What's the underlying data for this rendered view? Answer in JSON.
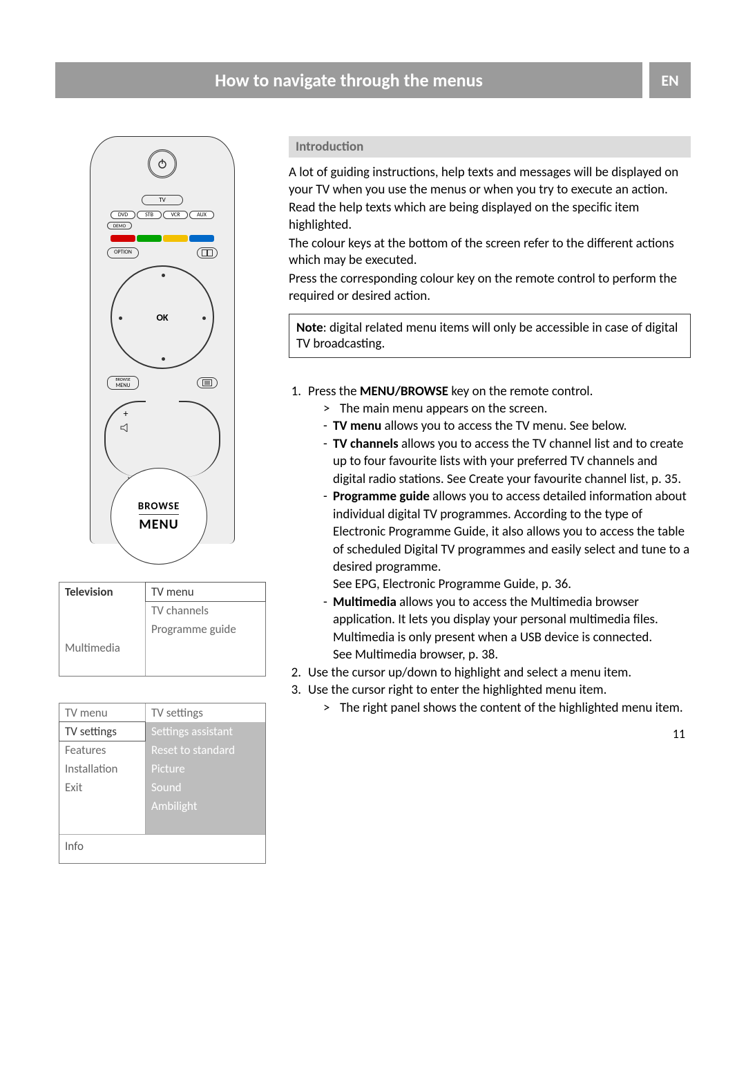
{
  "header": {
    "title": "How to navigate through the menus",
    "lang": "EN"
  },
  "remote": {
    "tv_label": "TV",
    "sources": [
      "DVD",
      "STB",
      "VCR",
      "AUX"
    ],
    "demo_label": "DEMO",
    "option_label": "OPTION",
    "ok_label": "OK",
    "menu_top": "BROWSE",
    "menu_bottom": "MENU",
    "plus": "+",
    "callout_browse": "BROWSE",
    "callout_menu": "MENU",
    "colours": {
      "red": "#d30000",
      "green": "#00a300",
      "yellow": "#f3c000",
      "blue": "#0068c8"
    }
  },
  "osd1": {
    "left": [
      "Television",
      "Multimedia"
    ],
    "right_header": "TV menu",
    "right_items": [
      "TV channels",
      "Programme guide"
    ]
  },
  "osd2": {
    "left_header": "TV menu",
    "left_items": [
      "TV settings",
      "Features",
      "Installation",
      "Exit"
    ],
    "right_header": "TV settings",
    "right_items": [
      "Settings assistant",
      "Reset to standard",
      "Picture",
      "Sound",
      "Ambilight"
    ],
    "info_label": "Info"
  },
  "intro": {
    "heading": "Introduction",
    "p1": "A lot of guiding instructions, help texts and messages will be displayed on your TV when you use the menus or when you try to execute an action.",
    "p2": "Read the help texts which are being displayed on the specific item highlighted.",
    "p3": "The colour keys at the bottom of the screen refer to the different actions which may be executed.",
    "p4": "Press the corresponding colour key on the remote control to perform the required or desired action.",
    "note_label": "Note",
    "note_text": ": digital related menu items will only be accessible in case of digital TV broadcasting."
  },
  "steps": {
    "s1_a": "Press the ",
    "s1_key": "MENU/BROWSE",
    "s1_b": " key on the remote control.",
    "s1_gt": "The main menu appears on the screen.",
    "d1_bold": "TV menu",
    "d1_rest": " allows you to access the TV menu. See below.",
    "d2_bold": "TV channels",
    "d2_rest": " allows you to access the TV channel list and to create up to four favourite lists with your preferred TV channels and digital radio stations. See Create your favourite channel list, p. 35.",
    "d3_bold": "Programme guide",
    "d3_rest": " allows you to access detailed information about individual digital TV programmes. According to the type of Electronic Programme Guide, it also allows you to access the table of scheduled Digital TV programmes and easily select and tune to a desired programme.",
    "d3_extra": "See EPG, Electronic Programme Guide, p. 36.",
    "d4_bold": "Multimedia",
    "d4_rest": " allows you to access the Multimedia browser application. It lets you display your personal multimedia files. Multimedia is only present when a USB device is connected.",
    "d4_extra": "See Multimedia browser, p. 38.",
    "s2": "Use the cursor up/down to highlight and select a menu item.",
    "s3": "Use the cursor right to enter the highlighted menu item.",
    "s3_gt": "The right panel shows the content of the highlighted menu item."
  },
  "page_number": "11"
}
